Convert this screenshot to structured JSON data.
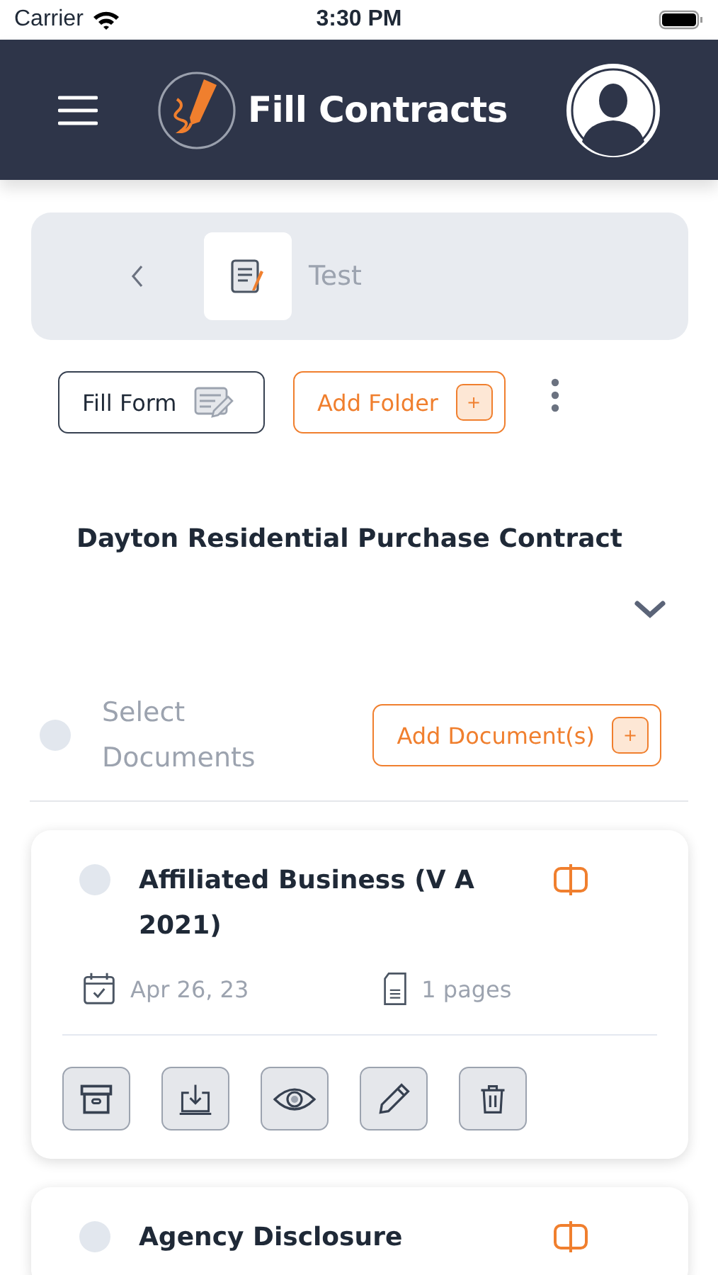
{
  "status_bar": {
    "carrier": "Carrier",
    "time": "3:30 PM"
  },
  "header": {
    "title": "Fill Contracts"
  },
  "breadcrumb": {
    "label": "Test"
  },
  "actions": {
    "fill_form": "Fill Form",
    "add_folder": "Add Folder",
    "add_folder_plus": "+"
  },
  "contract": {
    "title": "Dayton Residential Purchase Contract",
    "expanded": false
  },
  "select_all": {
    "label": "Select Documents",
    "checked": false
  },
  "add_document": {
    "label": "Add Document(s)",
    "plus": "+"
  },
  "documents": [
    {
      "title": "Affiliated Business (V A 2021)",
      "date": "Apr 26, 23",
      "pages": "1 pages",
      "checked": false
    },
    {
      "title": "Agency Disclosure",
      "checked": false
    }
  ]
}
